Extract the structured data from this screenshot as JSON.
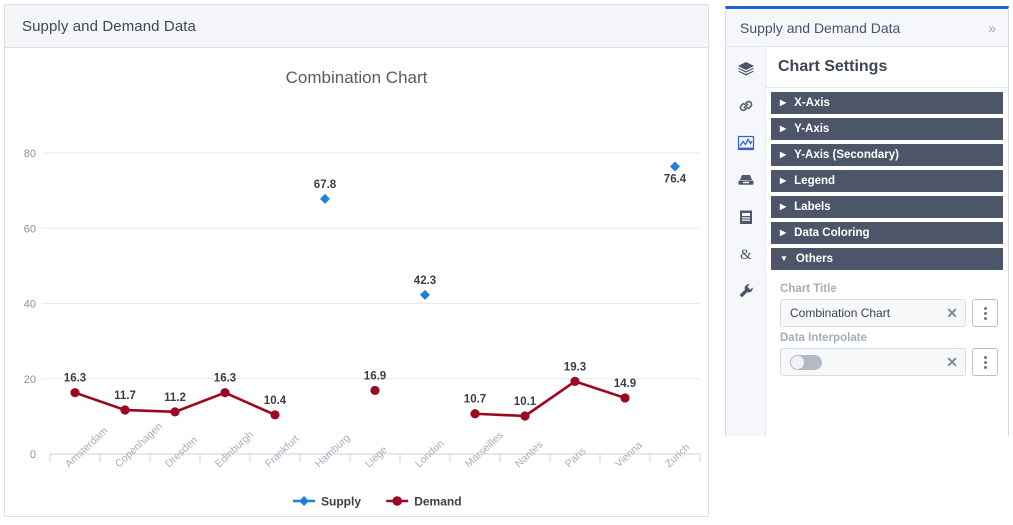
{
  "card": {
    "title": "Supply and Demand Data"
  },
  "panel": {
    "title": "Supply and Demand Data",
    "collapse_icon": "»",
    "heading": "Chart Settings",
    "rail_icons": [
      {
        "name": "layers-icon"
      },
      {
        "name": "link-icon"
      },
      {
        "name": "chart-icon"
      },
      {
        "name": "archive-icon"
      },
      {
        "name": "clipboard-icon"
      },
      {
        "name": "ampersand-icon"
      },
      {
        "name": "wrench-icon"
      }
    ],
    "sections": [
      {
        "label": "X-Axis",
        "expanded": false,
        "marker": "▶"
      },
      {
        "label": "Y-Axis",
        "expanded": false,
        "marker": "▶"
      },
      {
        "label": "Y-Axis (Secondary)",
        "expanded": false,
        "marker": "▶"
      },
      {
        "label": "Legend",
        "expanded": false,
        "marker": "▶"
      },
      {
        "label": "Labels",
        "expanded": false,
        "marker": "▶"
      },
      {
        "label": "Data Coloring",
        "expanded": false,
        "marker": "▶"
      },
      {
        "label": "Others",
        "expanded": true,
        "marker": "▼"
      }
    ],
    "fields": [
      {
        "label": "Chart Title",
        "value": "Combination Chart",
        "type": "text",
        "clear": "✕"
      },
      {
        "label": "Data Interpolate",
        "value": "",
        "type": "toggle",
        "toggle_on": false,
        "clear": "✕"
      }
    ]
  },
  "chart_data": {
    "type": "line",
    "title": "Combination Chart",
    "xlabel": "",
    "ylabel": "",
    "ylim": [
      0,
      80
    ],
    "yticks": [
      0,
      20,
      40,
      60,
      80
    ],
    "grid": true,
    "legend_position": "bottom",
    "categories": [
      "Amsterdam",
      "Copenhagen",
      "Dresden",
      "Edinburgh",
      "Frankfurt",
      "Hamburg",
      "Liege",
      "London",
      "Marseilles",
      "Nantes",
      "Paris",
      "Vienna",
      "Zurich"
    ],
    "series": [
      {
        "name": "Supply",
        "color": "#1f82d6",
        "marker": "diamond",
        "line": false,
        "values": [
          null,
          null,
          null,
          null,
          null,
          67.8,
          null,
          42.3,
          null,
          null,
          null,
          null,
          76.4
        ]
      },
      {
        "name": "Demand",
        "color": "#9c0824",
        "marker": "circle",
        "line": true,
        "values": [
          16.3,
          11.7,
          11.2,
          16.3,
          10.4,
          null,
          16.9,
          null,
          10.7,
          10.1,
          19.3,
          14.9,
          null
        ]
      }
    ]
  }
}
